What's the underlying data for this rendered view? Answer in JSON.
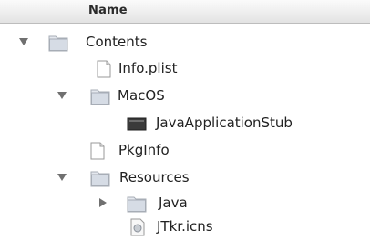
{
  "header": {
    "column_name": "Name"
  },
  "tree": {
    "contents": {
      "label": "Contents",
      "icon": "folder-icon",
      "expanded": true
    },
    "info_plist": {
      "label": "Info.plist",
      "icon": "document-icon"
    },
    "macos": {
      "label": "MacOS",
      "icon": "folder-icon",
      "expanded": true
    },
    "java_stub": {
      "label": "JavaApplicationStub",
      "icon": "executable-icon"
    },
    "pkginfo": {
      "label": "PkgInfo",
      "icon": "document-icon"
    },
    "resources": {
      "label": "Resources",
      "icon": "folder-icon",
      "expanded": true
    },
    "java": {
      "label": "Java",
      "icon": "folder-icon",
      "expanded": false
    },
    "jtkr_icns": {
      "label": "JTkr.icns",
      "icon": "icns-file-icon"
    }
  }
}
